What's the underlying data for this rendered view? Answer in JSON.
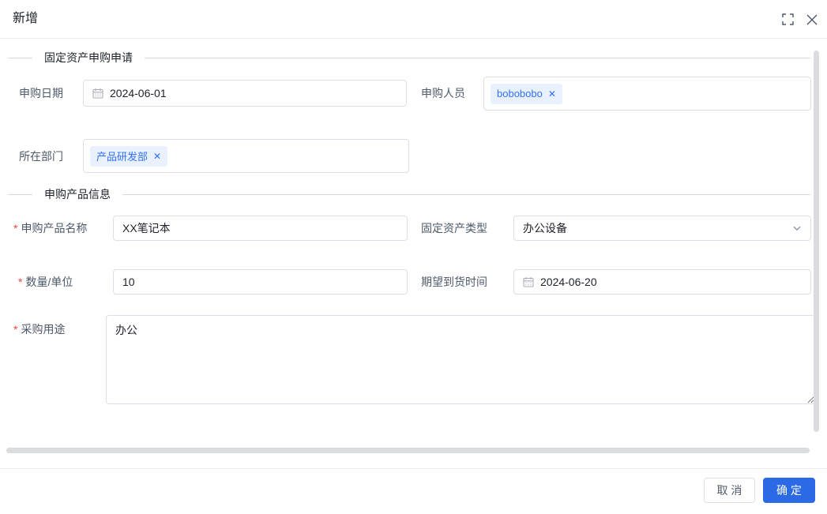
{
  "colors": {
    "primary": "#2b69e5",
    "tag_bg": "#e9f1fe",
    "tag_text": "#3370ff",
    "required_mark_color": "#f53f3f",
    "border": "#dcdfe6"
  },
  "dialog": {
    "title": "新增",
    "required_mark": "*",
    "glyphs": {
      "tag_close": "✕"
    },
    "sections": [
      {
        "title": "固定资产申购申请"
      },
      {
        "title": "申购产品信息"
      }
    ],
    "form": {
      "purchase_date": {
        "label": "申购日期",
        "value": "2024-06-01"
      },
      "purchase_person": {
        "label": "申购人员",
        "tags": [
          {
            "text": "bobobobo"
          }
        ]
      },
      "department": {
        "label": "所在部门",
        "tags": [
          {
            "text": "产品研发部"
          }
        ]
      },
      "product_name": {
        "label": "申购产品名称",
        "value": "XX笔记本",
        "required": true
      },
      "asset_type": {
        "label": "固定资产类型",
        "value": "办公设备"
      },
      "quantity": {
        "label": "数量/单位",
        "value": "10",
        "required": true
      },
      "expected_arrival": {
        "label": "期望到货时间",
        "value": "2024-06-20"
      },
      "purpose": {
        "label": "采购用途",
        "value": "办公",
        "required": true
      }
    },
    "footer": {
      "cancel_label": "取 消",
      "confirm_label": "确 定"
    }
  }
}
